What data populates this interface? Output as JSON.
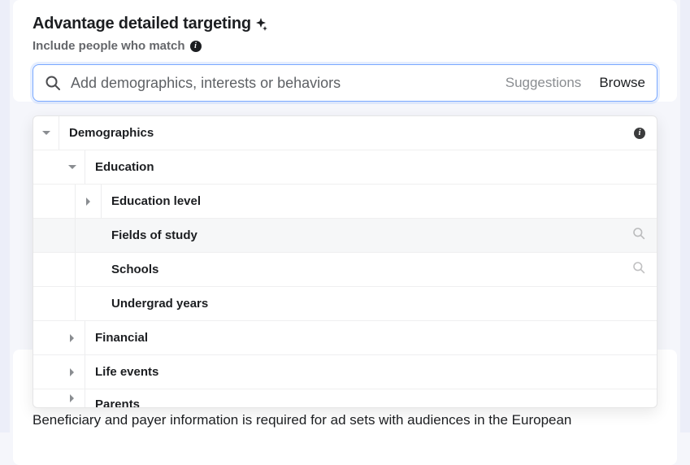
{
  "header": {
    "title": "Advantage detailed targeting",
    "subtitle": "Include people who match"
  },
  "search": {
    "placeholder": "Add demographics, interests or behaviors",
    "suggestions": "Suggestions",
    "browse": "Browse"
  },
  "tree": {
    "root": "Demographics",
    "nodes": [
      {
        "label": "Education",
        "expanded": true,
        "children": [
          {
            "label": "Education level",
            "expandable": true
          },
          {
            "label": "Fields of study",
            "searchable": true,
            "hover": true
          },
          {
            "label": "Schools",
            "searchable": true
          },
          {
            "label": "Undergrad years"
          }
        ]
      },
      {
        "label": "Financial",
        "expandable": true
      },
      {
        "label": "Life events",
        "expandable": true
      },
      {
        "label": "Parents",
        "expandable": true
      }
    ]
  },
  "footer": {
    "text": "Beneficiary and payer information is required for ad sets with audiences in the European"
  }
}
